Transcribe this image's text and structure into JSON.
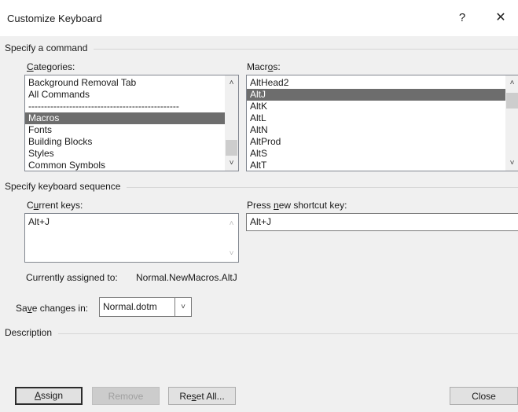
{
  "window": {
    "title": "Customize Keyboard",
    "help": "?",
    "close": "✕"
  },
  "command_section": {
    "heading": "Specify a command",
    "categories": {
      "label_pre": "",
      "label_key": "C",
      "label_post": "ategories:",
      "items": [
        "Background Removal Tab",
        "All Commands",
        "------------------------------------------------",
        "Macros",
        "Fonts",
        "Building Blocks",
        "Styles",
        "Common Symbols"
      ],
      "selected": "Macros"
    },
    "macros": {
      "label_pre": "Macr",
      "label_key": "o",
      "label_post": "s:",
      "items": [
        "AltHead2",
        "AltJ",
        "AltK",
        "AltL",
        "AltN",
        "AltProd",
        "AltS",
        "AltT"
      ],
      "selected": "AltJ"
    }
  },
  "keyboard_section": {
    "heading": "Specify keyboard sequence",
    "current_keys": {
      "label_pre": "C",
      "label_key": "u",
      "label_post": "rrent keys:",
      "items": [
        "Alt+J"
      ]
    },
    "new_shortcut": {
      "label_pre": "Press ",
      "label_key": "n",
      "label_post": "ew shortcut key:",
      "value": "Alt+J"
    },
    "assigned_label": "Currently assigned to:",
    "assigned_value": "Normal.NewMacros.AltJ"
  },
  "save": {
    "label_pre": "Sa",
    "label_key": "v",
    "label_post": "e changes in:",
    "value": "Normal.dotm"
  },
  "description": {
    "heading": "Description"
  },
  "buttons": {
    "assign": {
      "pre": "",
      "key": "A",
      "post": "ssign"
    },
    "remove": {
      "label": "Remove"
    },
    "reset": {
      "pre": "Re",
      "key": "s",
      "post": "et All..."
    },
    "close": {
      "label": "Close"
    }
  },
  "icons": {
    "scroll_up": "chevron-up-icon",
    "scroll_down": "chevron-down-icon",
    "dropdown": "chevron-down-icon"
  }
}
